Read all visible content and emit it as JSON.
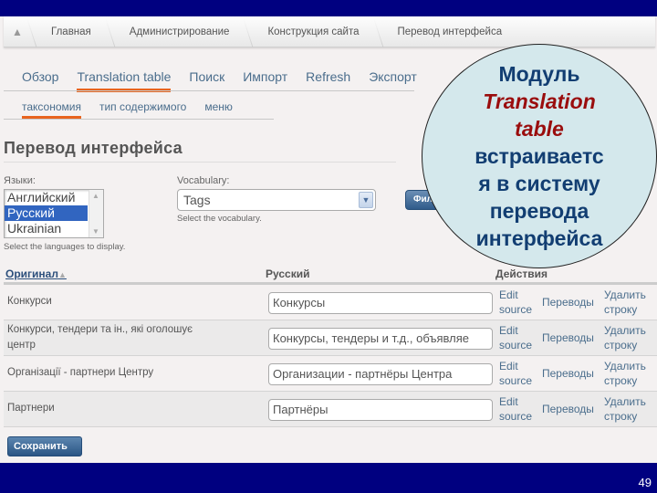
{
  "breadcrumb": {
    "home_icon": "home-icon",
    "items": [
      "Главная",
      "Администрирование",
      "Конструкция сайта",
      "Перевод интерфейса"
    ]
  },
  "tabs": [
    {
      "label": "Обзор",
      "active": false
    },
    {
      "label": "Translation table",
      "active": true
    },
    {
      "label": "Поиск",
      "active": false
    },
    {
      "label": "Импорт",
      "active": false
    },
    {
      "label": "Refresh",
      "active": false
    },
    {
      "label": "Экспорт",
      "active": false
    }
  ],
  "subtabs": [
    {
      "label": "таксономия",
      "active": true
    },
    {
      "label": "тип содержимого",
      "active": false
    },
    {
      "label": "меню",
      "active": false
    }
  ],
  "page_title": "Перевод интерфейса",
  "filters": {
    "languages_label": "Языки:",
    "languages": [
      "Английский",
      "Русский",
      "Ukrainian"
    ],
    "languages_selected": "Русский",
    "languages_help": "Select the languages to display.",
    "vocabulary_label": "Vocabulary:",
    "vocabulary_value": "Tags",
    "vocabulary_help": "Select the vocabulary.",
    "filter_button": "Фильтр"
  },
  "callout": {
    "line1": "Модуль",
    "line2": "Translation",
    "line3": "table",
    "line4": "встраиваетс",
    "line5": "я в систему",
    "line6": "перевода",
    "line7": "интерфейса"
  },
  "table": {
    "headers": {
      "original": "Оригинал",
      "russian": "Русский",
      "actions": "Действия"
    },
    "sort_icon": "sort-ascending-icon",
    "rows": [
      {
        "original": "Конкурси",
        "russian": "Конкурсы",
        "edit": "Edit source",
        "translations": "Переводы",
        "delete": "Удалить строку"
      },
      {
        "original": "Конкурси, тендери та ін., які оголошує центр",
        "russian": "Конкурсы, тендеры и т.д., объявляе",
        "edit": "Edit source",
        "translations": "Переводы",
        "delete": "Удалить строку"
      },
      {
        "original": "Організації - партнери Центру",
        "russian": "Организации - партнёры Центра",
        "edit": "Edit source",
        "translations": "Переводы",
        "delete": "Удалить строку"
      },
      {
        "original": "Партнери",
        "russian": "Партнёры",
        "edit": "Edit source",
        "translations": "Переводы",
        "delete": "Удалить строку"
      }
    ]
  },
  "save_button": "Сохранить",
  "slide_number": "49"
}
